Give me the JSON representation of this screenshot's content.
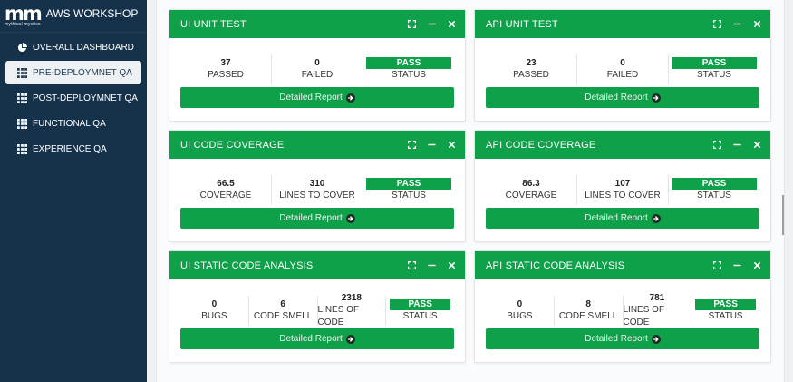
{
  "brand": {
    "logo_text": "mm",
    "logo_sub": "mythical mystics",
    "app_title": "AWS WORKSHOP"
  },
  "sidebar": {
    "items": [
      {
        "label": "OVERALL DASHBOARD",
        "icon": "pie-chart-icon",
        "active": false
      },
      {
        "label": "PRE-DEPLOYMNET QA",
        "icon": "grid-icon",
        "active": true
      },
      {
        "label": "POST-DEPLOYMNET QA",
        "icon": "grid-icon",
        "active": false
      },
      {
        "label": "FUNCTIONAL QA",
        "icon": "grid-icon",
        "active": false
      },
      {
        "label": "EXPERIENCE QA",
        "icon": "grid-icon",
        "active": false
      }
    ]
  },
  "colors": {
    "accent": "#0fa04a",
    "sidebar": "#16324a"
  },
  "cards": [
    {
      "title": "UI UNIT TEST",
      "button": "Detailed Report",
      "stats": [
        {
          "value": "37",
          "label": "PASSED"
        },
        {
          "value": "0",
          "label": "FAILED"
        }
      ],
      "status": {
        "value": "PASS",
        "label": "STATUS"
      }
    },
    {
      "title": "API UNIT TEST",
      "button": "Detailed Report",
      "stats": [
        {
          "value": "23",
          "label": "PASSED"
        },
        {
          "value": "0",
          "label": "FAILED"
        }
      ],
      "status": {
        "value": "PASS",
        "label": "STATUS"
      }
    },
    {
      "title": "UI CODE COVERAGE",
      "button": "Detailed Report",
      "stats": [
        {
          "value": "66.5",
          "label": "COVERAGE"
        },
        {
          "value": "310",
          "label": "LINES TO COVER"
        }
      ],
      "status": {
        "value": "PASS",
        "label": "STATUS"
      }
    },
    {
      "title": "API CODE COVERAGE",
      "button": "Detailed Report",
      "stats": [
        {
          "value": "86.3",
          "label": "COVERAGE"
        },
        {
          "value": "107",
          "label": "LINES TO COVER"
        }
      ],
      "status": {
        "value": "PASS",
        "label": "STATUS"
      }
    },
    {
      "title": "UI STATIC CODE ANALYSIS",
      "button": "Detailed Report",
      "stats": [
        {
          "value": "0",
          "label": "BUGS"
        },
        {
          "value": "6",
          "label": "CODE SMELL"
        },
        {
          "value": "2318",
          "label": "LINES OF CODE"
        }
      ],
      "status": {
        "value": "PASS",
        "label": "STATUS"
      }
    },
    {
      "title": "API STATIC CODE ANALYSIS",
      "button": "Detailed Report",
      "stats": [
        {
          "value": "0",
          "label": "BUGS"
        },
        {
          "value": "8",
          "label": "CODE SMELL"
        },
        {
          "value": "781",
          "label": "LINES OF CODE"
        }
      ],
      "status": {
        "value": "PASS",
        "label": "STATUS"
      }
    }
  ]
}
